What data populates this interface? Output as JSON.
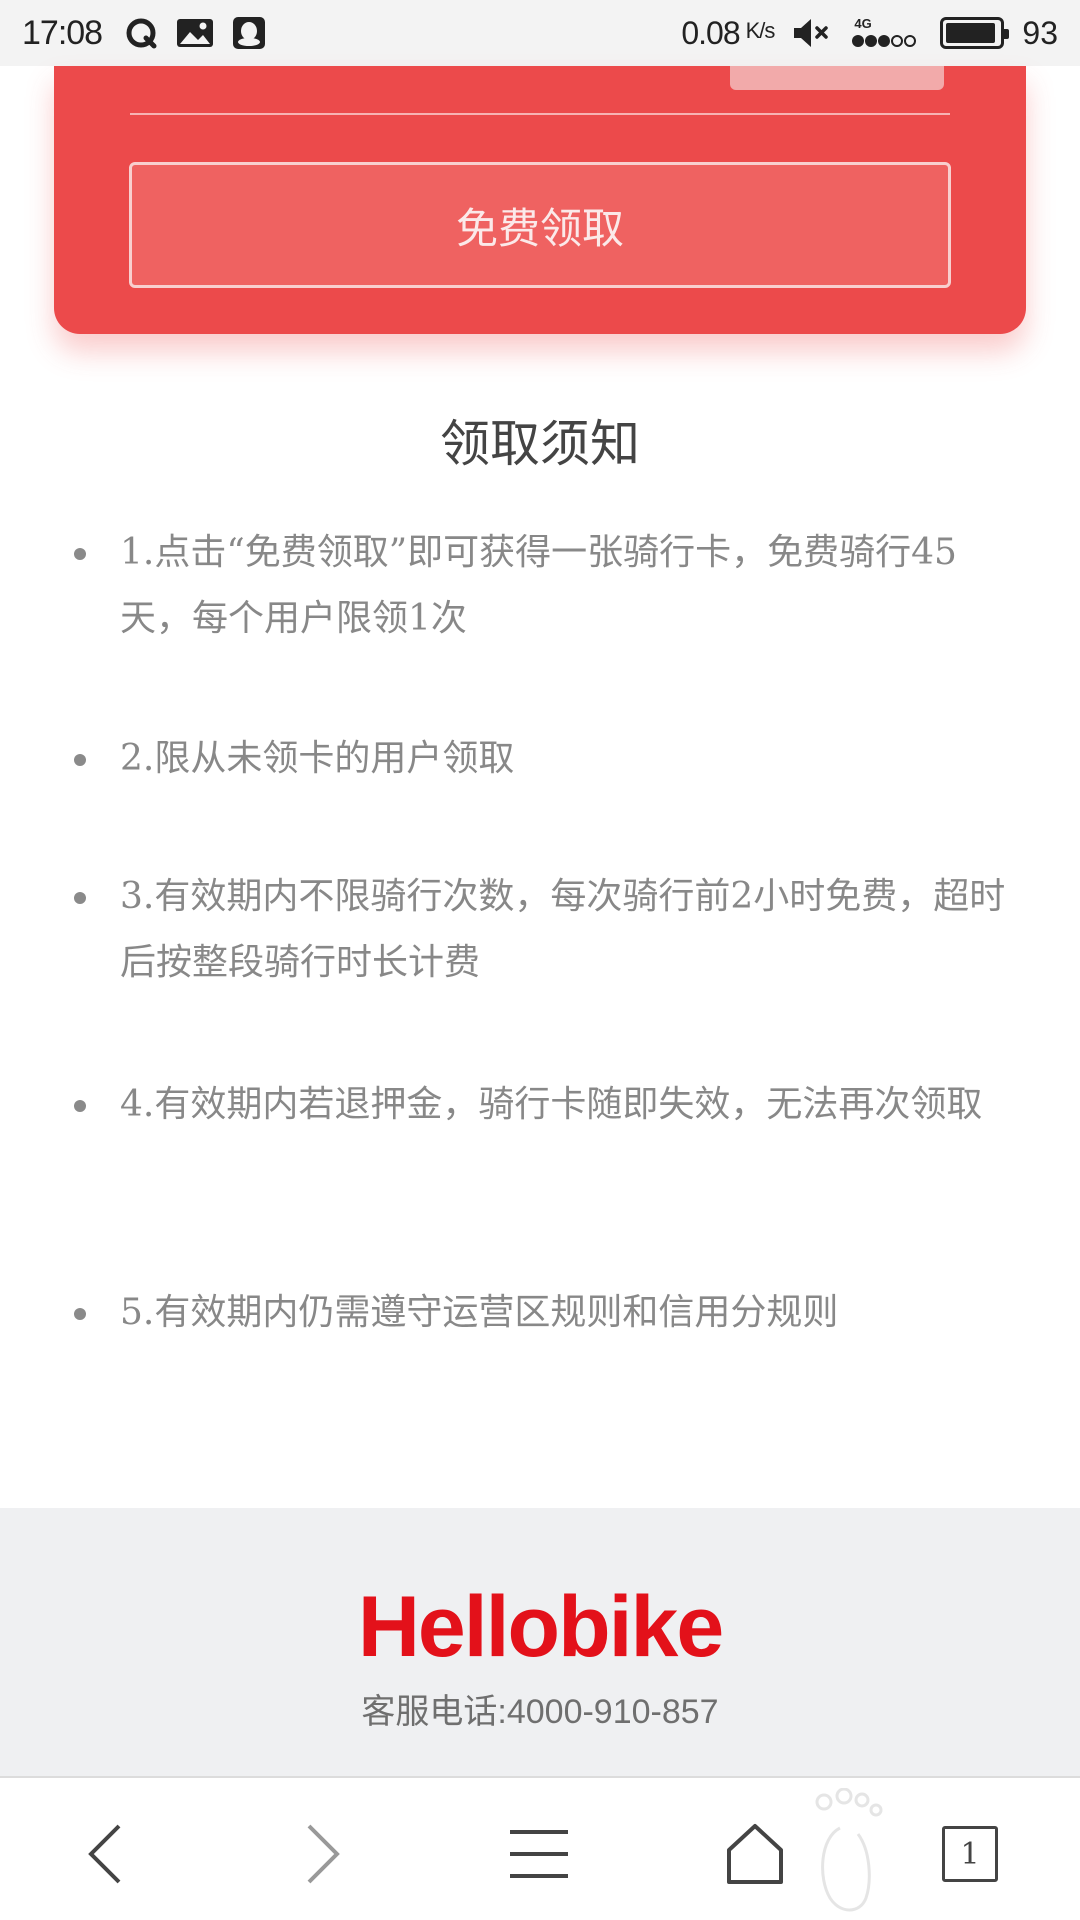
{
  "status_bar": {
    "time": "17:08",
    "speed": "0.08",
    "speed_unit": "K/s",
    "network": "4G",
    "battery": "93",
    "battery_level": 0.93,
    "icons": [
      "qq-browser-icon",
      "gallery-icon",
      "qq-icon",
      "mute-icon",
      "signal-icon",
      "battery-icon"
    ]
  },
  "card": {
    "claim_button_label": "免费领取"
  },
  "notice": {
    "title": "领取须知",
    "items": [
      "1.点击“免费领取”即可获得一张骑行卡，免费骑行45天，每个用户限领1次",
      "2.限从未领卡的用户领取",
      "3.有效期内不限骑行次数，每次骑行前2小时免费，超时后按整段骑行时长计费",
      "4.有效期内若退押金，骑行卡随即失效，无法再次领取",
      "5.有效期内仍需遵守运营区规则和信用分规则"
    ]
  },
  "footer": {
    "logo": "Hellobike",
    "phone": "客服电话:4000-910-857",
    "brand_color": "#e3111a"
  },
  "bottom_nav": {
    "icons": [
      "back-icon",
      "forward-icon",
      "menu-icon",
      "home-icon",
      "tabs-icon"
    ],
    "tab_count": "1"
  },
  "colors": {
    "card_red": "#ec4a4b",
    "button_red": "#ef6261"
  }
}
